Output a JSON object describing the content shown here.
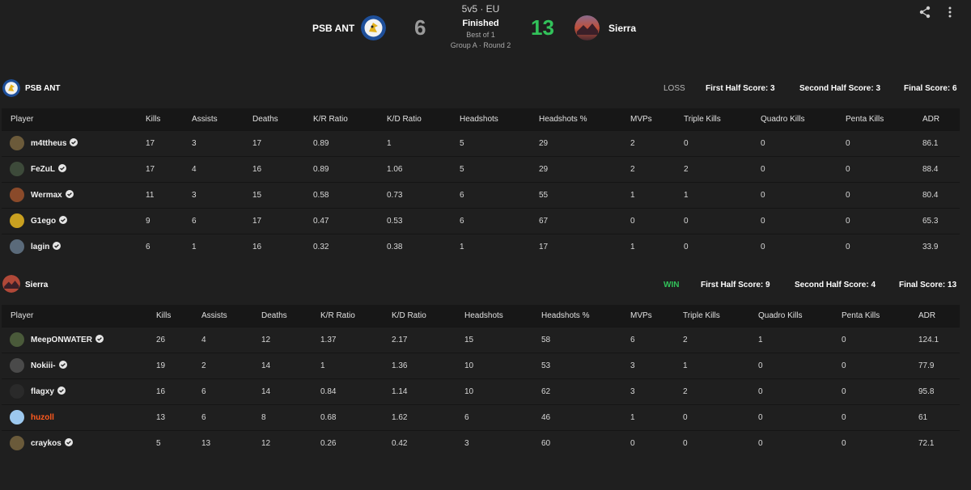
{
  "match": {
    "format": "5v5 · EU",
    "status": "Finished",
    "best_of": "Best of 1",
    "group": "Group A · Round 2",
    "team1": {
      "name": "PSB ANT",
      "score": "6"
    },
    "team2": {
      "name": "Sierra",
      "score": "13"
    }
  },
  "icons": {
    "share": "share-icon",
    "more": "more-vertical-icon",
    "verified": "verified-check-icon"
  },
  "colors": {
    "win": "#32c25a",
    "loss": "#b8b8b8",
    "highlight": "#ff5a1f"
  },
  "columns": [
    "Player",
    "Kills",
    "Assists",
    "Deaths",
    "K/R Ratio",
    "K/D Ratio",
    "Headshots",
    "Headshots %",
    "MVPs",
    "Triple Kills",
    "Quadro Kills",
    "Penta Kills",
    "ADR"
  ],
  "teams": [
    {
      "name": "PSB ANT",
      "result": "LOSS",
      "first_half": "First Half Score: 3",
      "second_half": "Second Half Score: 3",
      "final": "Final Score: 6",
      "players": [
        {
          "name": "m4ttheus",
          "verified": true,
          "stats": [
            "17",
            "3",
            "17",
            "0.89",
            "1",
            "5",
            "29",
            "2",
            "0",
            "0",
            "0",
            "86.1"
          ]
        },
        {
          "name": "FeZuL",
          "verified": true,
          "stats": [
            "17",
            "4",
            "16",
            "0.89",
            "1.06",
            "5",
            "29",
            "2",
            "2",
            "0",
            "0",
            "88.4"
          ]
        },
        {
          "name": "Wermax",
          "verified": true,
          "stats": [
            "11",
            "3",
            "15",
            "0.58",
            "0.73",
            "6",
            "55",
            "1",
            "1",
            "0",
            "0",
            "80.4"
          ]
        },
        {
          "name": "G1ego",
          "verified": true,
          "stats": [
            "9",
            "6",
            "17",
            "0.47",
            "0.53",
            "6",
            "67",
            "0",
            "0",
            "0",
            "0",
            "65.3"
          ]
        },
        {
          "name": "lagin",
          "verified": true,
          "stats": [
            "6",
            "1",
            "16",
            "0.32",
            "0.38",
            "1",
            "17",
            "1",
            "0",
            "0",
            "0",
            "33.9"
          ]
        }
      ]
    },
    {
      "name": "Sierra",
      "result": "WIN",
      "first_half": "First Half Score: 9",
      "second_half": "Second Half Score: 4",
      "final": "Final Score: 13",
      "players": [
        {
          "name": "MeepONWATER",
          "verified": true,
          "stats": [
            "26",
            "4",
            "12",
            "1.37",
            "2.17",
            "15",
            "58",
            "6",
            "2",
            "1",
            "0",
            "124.1"
          ]
        },
        {
          "name": "Nokiii-",
          "verified": true,
          "stats": [
            "19",
            "2",
            "14",
            "1",
            "1.36",
            "10",
            "53",
            "3",
            "1",
            "0",
            "0",
            "77.9"
          ]
        },
        {
          "name": "flagxy",
          "verified": true,
          "stats": [
            "16",
            "6",
            "14",
            "0.84",
            "1.14",
            "10",
            "62",
            "3",
            "2",
            "0",
            "0",
            "95.8"
          ]
        },
        {
          "name": "huzoll",
          "verified": false,
          "highlight": true,
          "stats": [
            "13",
            "6",
            "8",
            "0.68",
            "1.62",
            "6",
            "46",
            "1",
            "0",
            "0",
            "0",
            "61"
          ]
        },
        {
          "name": "craykos",
          "verified": true,
          "stats": [
            "5",
            "13",
            "12",
            "0.26",
            "0.42",
            "3",
            "60",
            "0",
            "0",
            "0",
            "0",
            "72.1"
          ]
        }
      ]
    }
  ]
}
